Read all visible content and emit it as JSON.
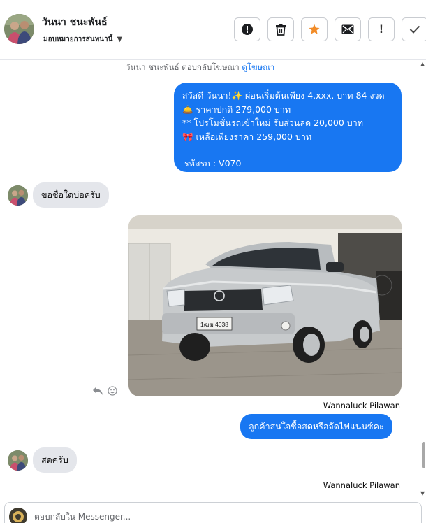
{
  "header": {
    "contact_name": "วันนา ชนะพันธ์",
    "assign_label": "มอบหมายการสนทนานี้",
    "actions": [
      {
        "name": "mark-spam-button",
        "icon": "alert-circle-icon"
      },
      {
        "name": "delete-button",
        "icon": "trash-icon"
      },
      {
        "name": "star-button",
        "icon": "star-icon",
        "color": "#f28c28"
      },
      {
        "name": "mark-unread-button",
        "icon": "envelope-icon"
      },
      {
        "name": "follow-up-button",
        "icon": "exclamation-icon",
        "glyph": "!"
      },
      {
        "name": "done-button",
        "icon": "check-icon"
      }
    ]
  },
  "conversation": {
    "system_text": "วันนา ชนะพันธ์ ตอบกลับโฆษณา",
    "system_link": "ดูโฆษณา",
    "ad_message": {
      "lines": [
        "สวัสดี วันนา!✨  ผ่อนเริ่มต้นเพียง 4,xxx. บาท 84 งวด",
        "🛎️ ราคาปกติ 279,000 บาท",
        "** โปรโมชั่นรถเข้าใหม่ รับส่วนลด 20,000 บาท",
        "🎀 เหลือเพียงราคา 259,000 บาท"
      ],
      "code": "รหัสรถ : V070"
    },
    "incoming_1": "ขอชื่อใดบ่อครับ",
    "photo": {
      "alt": "Silver Toyota Hilux Vigo pickup in showroom",
      "plate": "1ฒฆ 4038"
    },
    "sender_1": "Wannaluck Pilawan",
    "outgoing_reply": "ลูกค้าสนใจซื้อสดหรือจัดไฟแนนซ์คะ",
    "incoming_2": "สดครับ",
    "sender_2": "Wannaluck Pilawan"
  },
  "composer": {
    "placeholder": "ตอบกลับใน Messenger..."
  },
  "colors": {
    "brand_blue": "#1877f2",
    "incoming_bg": "#e4e6eb",
    "star": "#f28c28"
  }
}
